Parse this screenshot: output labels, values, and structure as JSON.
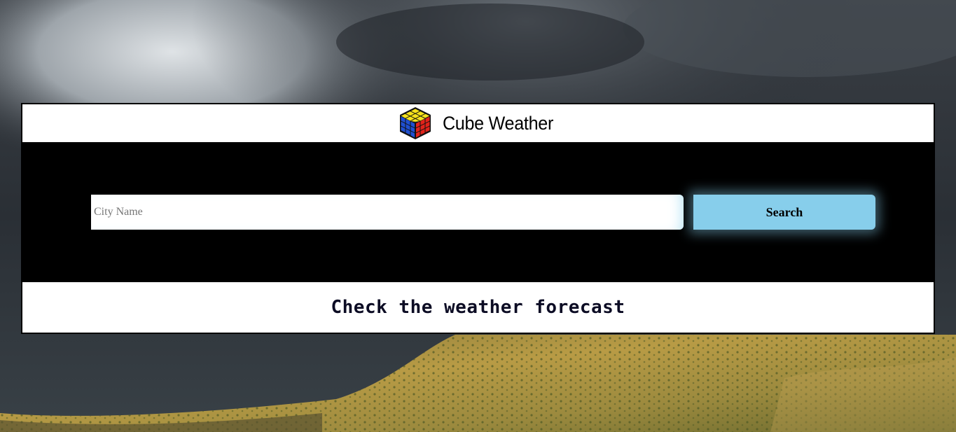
{
  "header": {
    "title": "Cube Weather",
    "logo_icon": "rubiks-cube-icon"
  },
  "search": {
    "placeholder": "City Name",
    "value": "",
    "button_label": "Search"
  },
  "footer": {
    "tagline": "Check the weather forecast"
  },
  "colors": {
    "card_background": "#ffffff",
    "band_background": "#000000",
    "search_button": "#87ceeb",
    "tagline_text": "#0c0c24"
  }
}
